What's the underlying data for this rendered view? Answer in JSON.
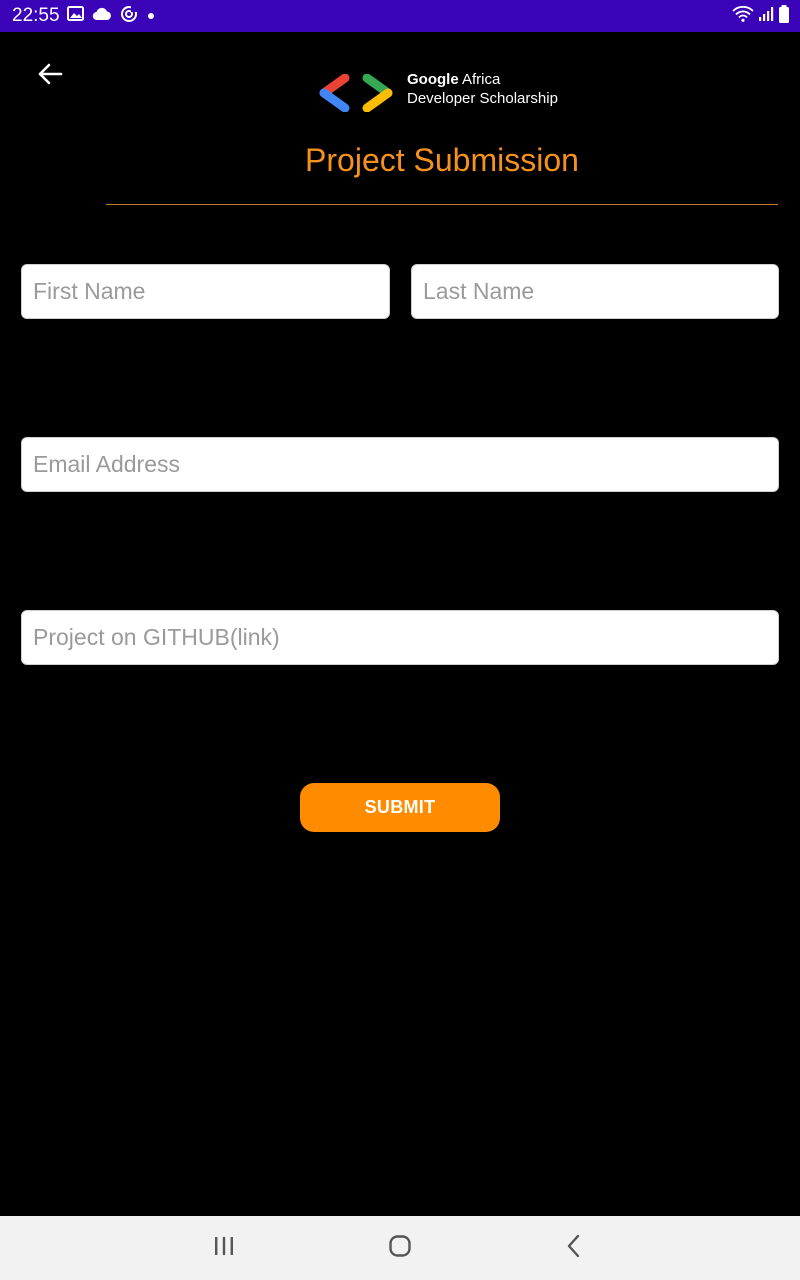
{
  "status_bar": {
    "time": "22:55",
    "background": "#3a03b8",
    "left_icons": [
      "image-icon",
      "cloud-icon",
      "sync-icon",
      "dot-icon"
    ],
    "right_icons": [
      "wifi-icon",
      "signal-icon",
      "battery-icon"
    ]
  },
  "header": {
    "back_icon": "arrow-left-icon",
    "logo": {
      "line1_bold": "Google",
      "line1_rest": " Africa",
      "line2": "Developer Scholarship"
    },
    "title": "Project Submission",
    "title_color": "#f5921e"
  },
  "form": {
    "first_name": {
      "placeholder": "First Name",
      "value": ""
    },
    "last_name": {
      "placeholder": "Last Name",
      "value": ""
    },
    "email": {
      "placeholder": "Email Address",
      "value": ""
    },
    "github": {
      "placeholder": "Project on GITHUB(link)",
      "value": ""
    },
    "submit_label": "SUBMIT",
    "submit_color": "#ff8c00"
  },
  "nav_bar": {
    "items": [
      "recents-icon",
      "home-icon",
      "back-icon"
    ]
  }
}
